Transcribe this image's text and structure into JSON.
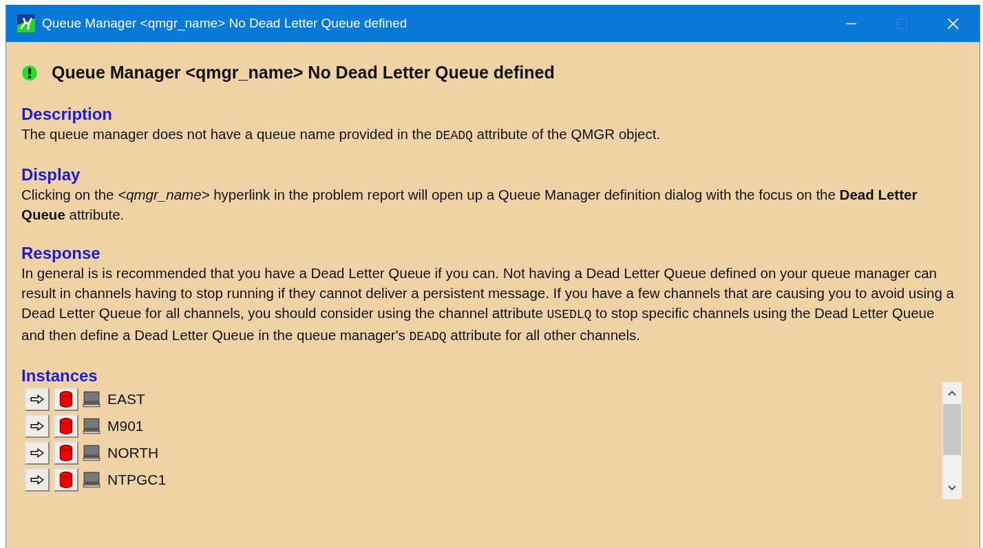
{
  "window": {
    "title": "Queue Manager <qmgr_name> No Dead Letter Queue defined"
  },
  "heading": "Queue Manager <qmgr_name> No Dead Letter Queue defined",
  "sections": [
    {
      "title": "Description",
      "parts": [
        {
          "kind": "plain",
          "text": "The queue manager does not have a queue name provided in the "
        },
        {
          "kind": "code",
          "text": "DEADQ"
        },
        {
          "kind": "plain",
          "text": " attribute of the QMGR object."
        }
      ]
    },
    {
      "title": "Display",
      "parts": [
        {
          "kind": "plain",
          "text": "Clicking on the "
        },
        {
          "kind": "italic",
          "text": "<qmgr_name>"
        },
        {
          "kind": "plain",
          "text": " hyperlink in the problem report will open up a Queue Manager definition dialog with the focus on the "
        },
        {
          "kind": "bold",
          "text": "Dead Letter Queue"
        },
        {
          "kind": "plain",
          "text": " attribute."
        }
      ]
    },
    {
      "title": "Response",
      "parts": [
        {
          "kind": "plain",
          "text": "In general is is recommended that you have a Dead Letter Queue if you can. Not having a Dead Letter Queue defined on your queue manager can result in channels having to stop running if they cannot deliver a persistent message. If you have a few channels that are causing you to avoid using a Dead Letter Queue for all channels, you should consider using the channel attribute "
        },
        {
          "kind": "code",
          "text": "USEDLQ"
        },
        {
          "kind": "plain",
          "text": " to stop specific channels using the Dead Letter Queue and then define a Dead Letter Queue in the queue manager's "
        },
        {
          "kind": "code",
          "text": "DEADQ"
        },
        {
          "kind": "plain",
          "text": " attribute for all other channels."
        }
      ]
    }
  ],
  "instances": {
    "title": "Instances",
    "items": [
      {
        "name": "EAST"
      },
      {
        "name": "M901"
      },
      {
        "name": "NORTH"
      },
      {
        "name": "NTPGC1"
      }
    ]
  }
}
